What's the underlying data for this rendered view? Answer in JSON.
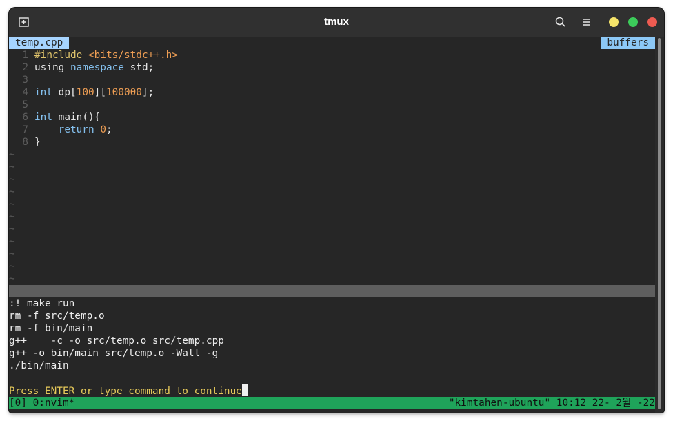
{
  "window": {
    "title": "tmux"
  },
  "titlebar_icons": {
    "new_tab": "new-tab-icon",
    "search": "search-icon",
    "menu": "hamburger-menu-icon"
  },
  "colors": {
    "minimize": "#f5e46a",
    "maximize": "#3ccc5a",
    "close": "#ee5b51",
    "tab_active_bg": "#a6d4ff",
    "statusbar_bg": "#1fa35a"
  },
  "nvim": {
    "tab_label": "temp.cpp",
    "buffers_label": "buffers",
    "lines": [
      {
        "num": "1",
        "tokens": [
          {
            "t": "#include ",
            "c": "c-pre"
          },
          {
            "t": "<bits/stdc++.h>",
            "c": "c-str"
          }
        ]
      },
      {
        "num": "2",
        "tokens": [
          {
            "t": "using ",
            "c": "c-def"
          },
          {
            "t": "namespace",
            "c": "c-kw"
          },
          {
            "t": " std;",
            "c": "c-def"
          }
        ]
      },
      {
        "num": "3",
        "tokens": []
      },
      {
        "num": "4",
        "tokens": [
          {
            "t": "int",
            "c": "c-kw"
          },
          {
            "t": " dp[",
            "c": "c-def"
          },
          {
            "t": "100",
            "c": "c-num"
          },
          {
            "t": "][",
            "c": "c-def"
          },
          {
            "t": "100000",
            "c": "c-num"
          },
          {
            "t": "];",
            "c": "c-def"
          }
        ]
      },
      {
        "num": "5",
        "tokens": []
      },
      {
        "num": "6",
        "tokens": [
          {
            "t": "int",
            "c": "c-kw"
          },
          {
            "t": " main(){",
            "c": "c-def"
          }
        ]
      },
      {
        "num": "7",
        "tokens": [
          {
            "t": "    ",
            "c": "c-def"
          },
          {
            "t": "return",
            "c": "c-kw"
          },
          {
            "t": " ",
            "c": "c-def"
          },
          {
            "t": "0",
            "c": "c-num"
          },
          {
            "t": ";",
            "c": "c-def"
          }
        ]
      },
      {
        "num": "8",
        "tokens": [
          {
            "t": "}",
            "c": "c-def"
          }
        ]
      }
    ],
    "tilde_count": 11,
    "tilde_char": "~"
  },
  "output": {
    "lines": [
      ":! make run",
      "rm -f src/temp.o",
      "rm -f bin/main",
      "g++    -c -o src/temp.o src/temp.cpp",
      "g++ -o bin/main src/temp.o -Wall -g",
      "./bin/main",
      ""
    ],
    "prompt": "Press ENTER or type command to continue"
  },
  "tmux_status": {
    "left": "[0] 0:nvim*",
    "right": "\"kimtahen-ubuntu\" 10:12 22- 2월 -22"
  }
}
